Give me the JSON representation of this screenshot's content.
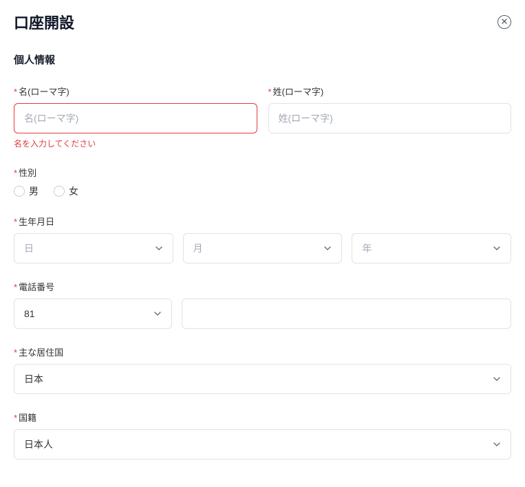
{
  "header": {
    "title": "口座開設"
  },
  "section": {
    "title": "個人情報"
  },
  "fields": {
    "firstName": {
      "label": "名(ローマ字)",
      "placeholder": "名(ローマ字)",
      "error": "名を入力してください"
    },
    "lastName": {
      "label": "姓(ローマ字)",
      "placeholder": "姓(ローマ字)"
    },
    "gender": {
      "label": "性別",
      "male": "男",
      "female": "女"
    },
    "dob": {
      "label": "生年月日",
      "day": "日",
      "month": "月",
      "year": "年"
    },
    "phone": {
      "label": "電話番号",
      "code": "81"
    },
    "residence": {
      "label": "主な居住国",
      "value": "日本"
    },
    "nationality": {
      "label": "国籍",
      "value": "日本人"
    }
  }
}
